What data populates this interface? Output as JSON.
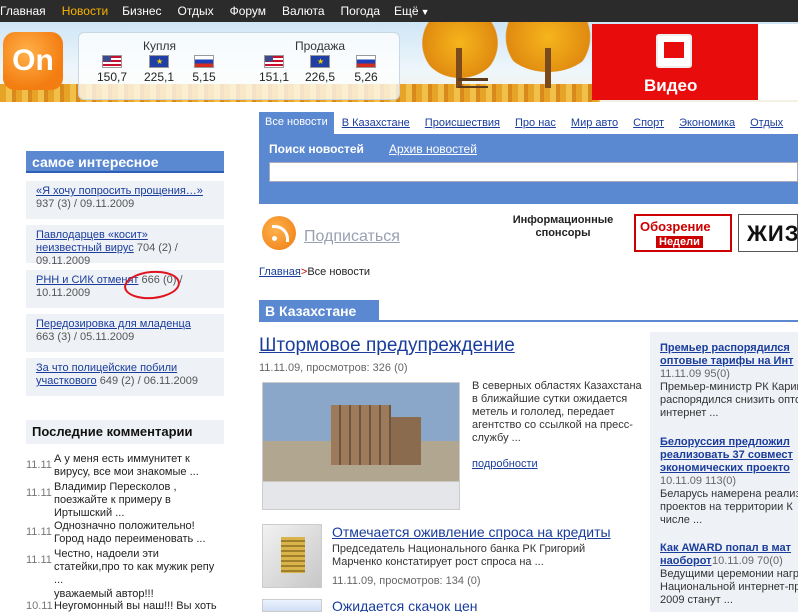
{
  "topnav": {
    "items": [
      {
        "label": "Главная"
      },
      {
        "label": "Новости"
      },
      {
        "label": "Бизнес"
      },
      {
        "label": "Отдых"
      },
      {
        "label": "Форум"
      },
      {
        "label": "Валюта"
      },
      {
        "label": "Погода"
      },
      {
        "label": "Ещё"
      }
    ],
    "active_index": 1
  },
  "logo": {
    "text": "On"
  },
  "rates": {
    "buy": {
      "title": "Купля",
      "values": [
        "150,7",
        "225,1",
        "5,15"
      ]
    },
    "sell": {
      "title": "Продажа",
      "values": [
        "151,1",
        "226,5",
        "5,26"
      ]
    }
  },
  "video_banner": {
    "label": "Видео"
  },
  "most_interesting": {
    "title": "самое интересное",
    "items": [
      {
        "link": "«Я хочу попросить прощения…»",
        "meta": "937 (3)  / 09.11.2009"
      },
      {
        "link": "Павлодарцев «косит» неизвестный вирус",
        "meta": "704 (2)  / 09.11.2009"
      },
      {
        "link": "РНН и СИК отменят",
        "meta": "666 (0)  / 10.11.2009"
      },
      {
        "link": "Передозировка для младенца",
        "meta": "663 (3)  / 05.11.2009"
      },
      {
        "link": "За что полицейские побили участкового",
        "meta": "649 (2)  / 06.11.2009"
      }
    ]
  },
  "comments": {
    "title": "Последние комментарии",
    "items": [
      {
        "date": "11.11",
        "text": "А у меня есть иммунитет к вирусу, все мои знакомые ..."
      },
      {
        "date": "11.11",
        "text": "Владимир Пересколов , поезжайте к примеру в Иртышский ..."
      },
      {
        "date": "11.11",
        "text": "Однозначно положительно! Город надо переименовать ..."
      },
      {
        "date": "11.11",
        "text": "Честно, надоели эти статейки,про то как мужик репу ..."
      },
      {
        "date": "",
        "text": "уважаемый автор!!!"
      },
      {
        "date": "10.11",
        "text": "Неугомонный вы наш!!! Вы хоть"
      }
    ]
  },
  "tabs": [
    {
      "label": "Все новости"
    },
    {
      "label": "В Казахстане"
    },
    {
      "label": "Происшествия"
    },
    {
      "label": "Про нас"
    },
    {
      "label": "Мир авто"
    },
    {
      "label": "Спорт"
    },
    {
      "label": "Экономика"
    },
    {
      "label": "Отдых"
    }
  ],
  "search": {
    "title": "Поиск новостей",
    "archive": "Архив новостей",
    "value": ""
  },
  "subscribe": {
    "label": "Подписаться"
  },
  "sponsors": {
    "label": "Информационные спонсоры",
    "s1_top": "Обозрение",
    "s1_bottom": "Недели",
    "s2": "ЖИЗ"
  },
  "breadcrumb": {
    "home": "Главная",
    "sep": ">",
    "current": "Все новости"
  },
  "section": {
    "title": "В Казахстане"
  },
  "main_story": {
    "headline": "Штормовое предупреждение",
    "meta": "11.11.09,   просмотров: 326 (0)",
    "lead": "В северных областях Казахстана в ближайшие сутки ожидается метель и гололед, передает агентство со ссылкой на пресс-службу ...",
    "more": "подробности"
  },
  "stories": [
    {
      "headline": "Отмечается оживление спроса на кредиты",
      "lead": "Председатель Национального банка РК Григорий Марченко констатирует рост спроса на ...",
      "meta": "11.11.09,   просмотров: 134 (0)"
    },
    {
      "headline": "Ожидается скачок цен"
    }
  ],
  "right_column": [
    {
      "headline": [
        "Премьер распорядился",
        "оптовые тарифы на Инт"
      ],
      "meta": "11.11.09 95(0)",
      "text": [
        "Премьер-министр РК Карим",
        "распорядился снизить опто",
        "интернет ..."
      ]
    },
    {
      "headline": [
        "Белоруссия предложил",
        "реализовать 37 совмест",
        "экономических проекто"
      ],
      "meta": "10.11.09 113(0)",
      "text": [
        "Беларусь намерена реализо",
        "проектов на территории К",
        "числе ..."
      ]
    },
    {
      "headline": [
        "Как AWARD попал в мат",
        "наоборот"
      ],
      "meta": "10.11.09 70(0)",
      "text": [
        "Ведущими церемонии награ",
        "Национальной интернет-пр",
        "2009 станут ..."
      ]
    }
  ]
}
